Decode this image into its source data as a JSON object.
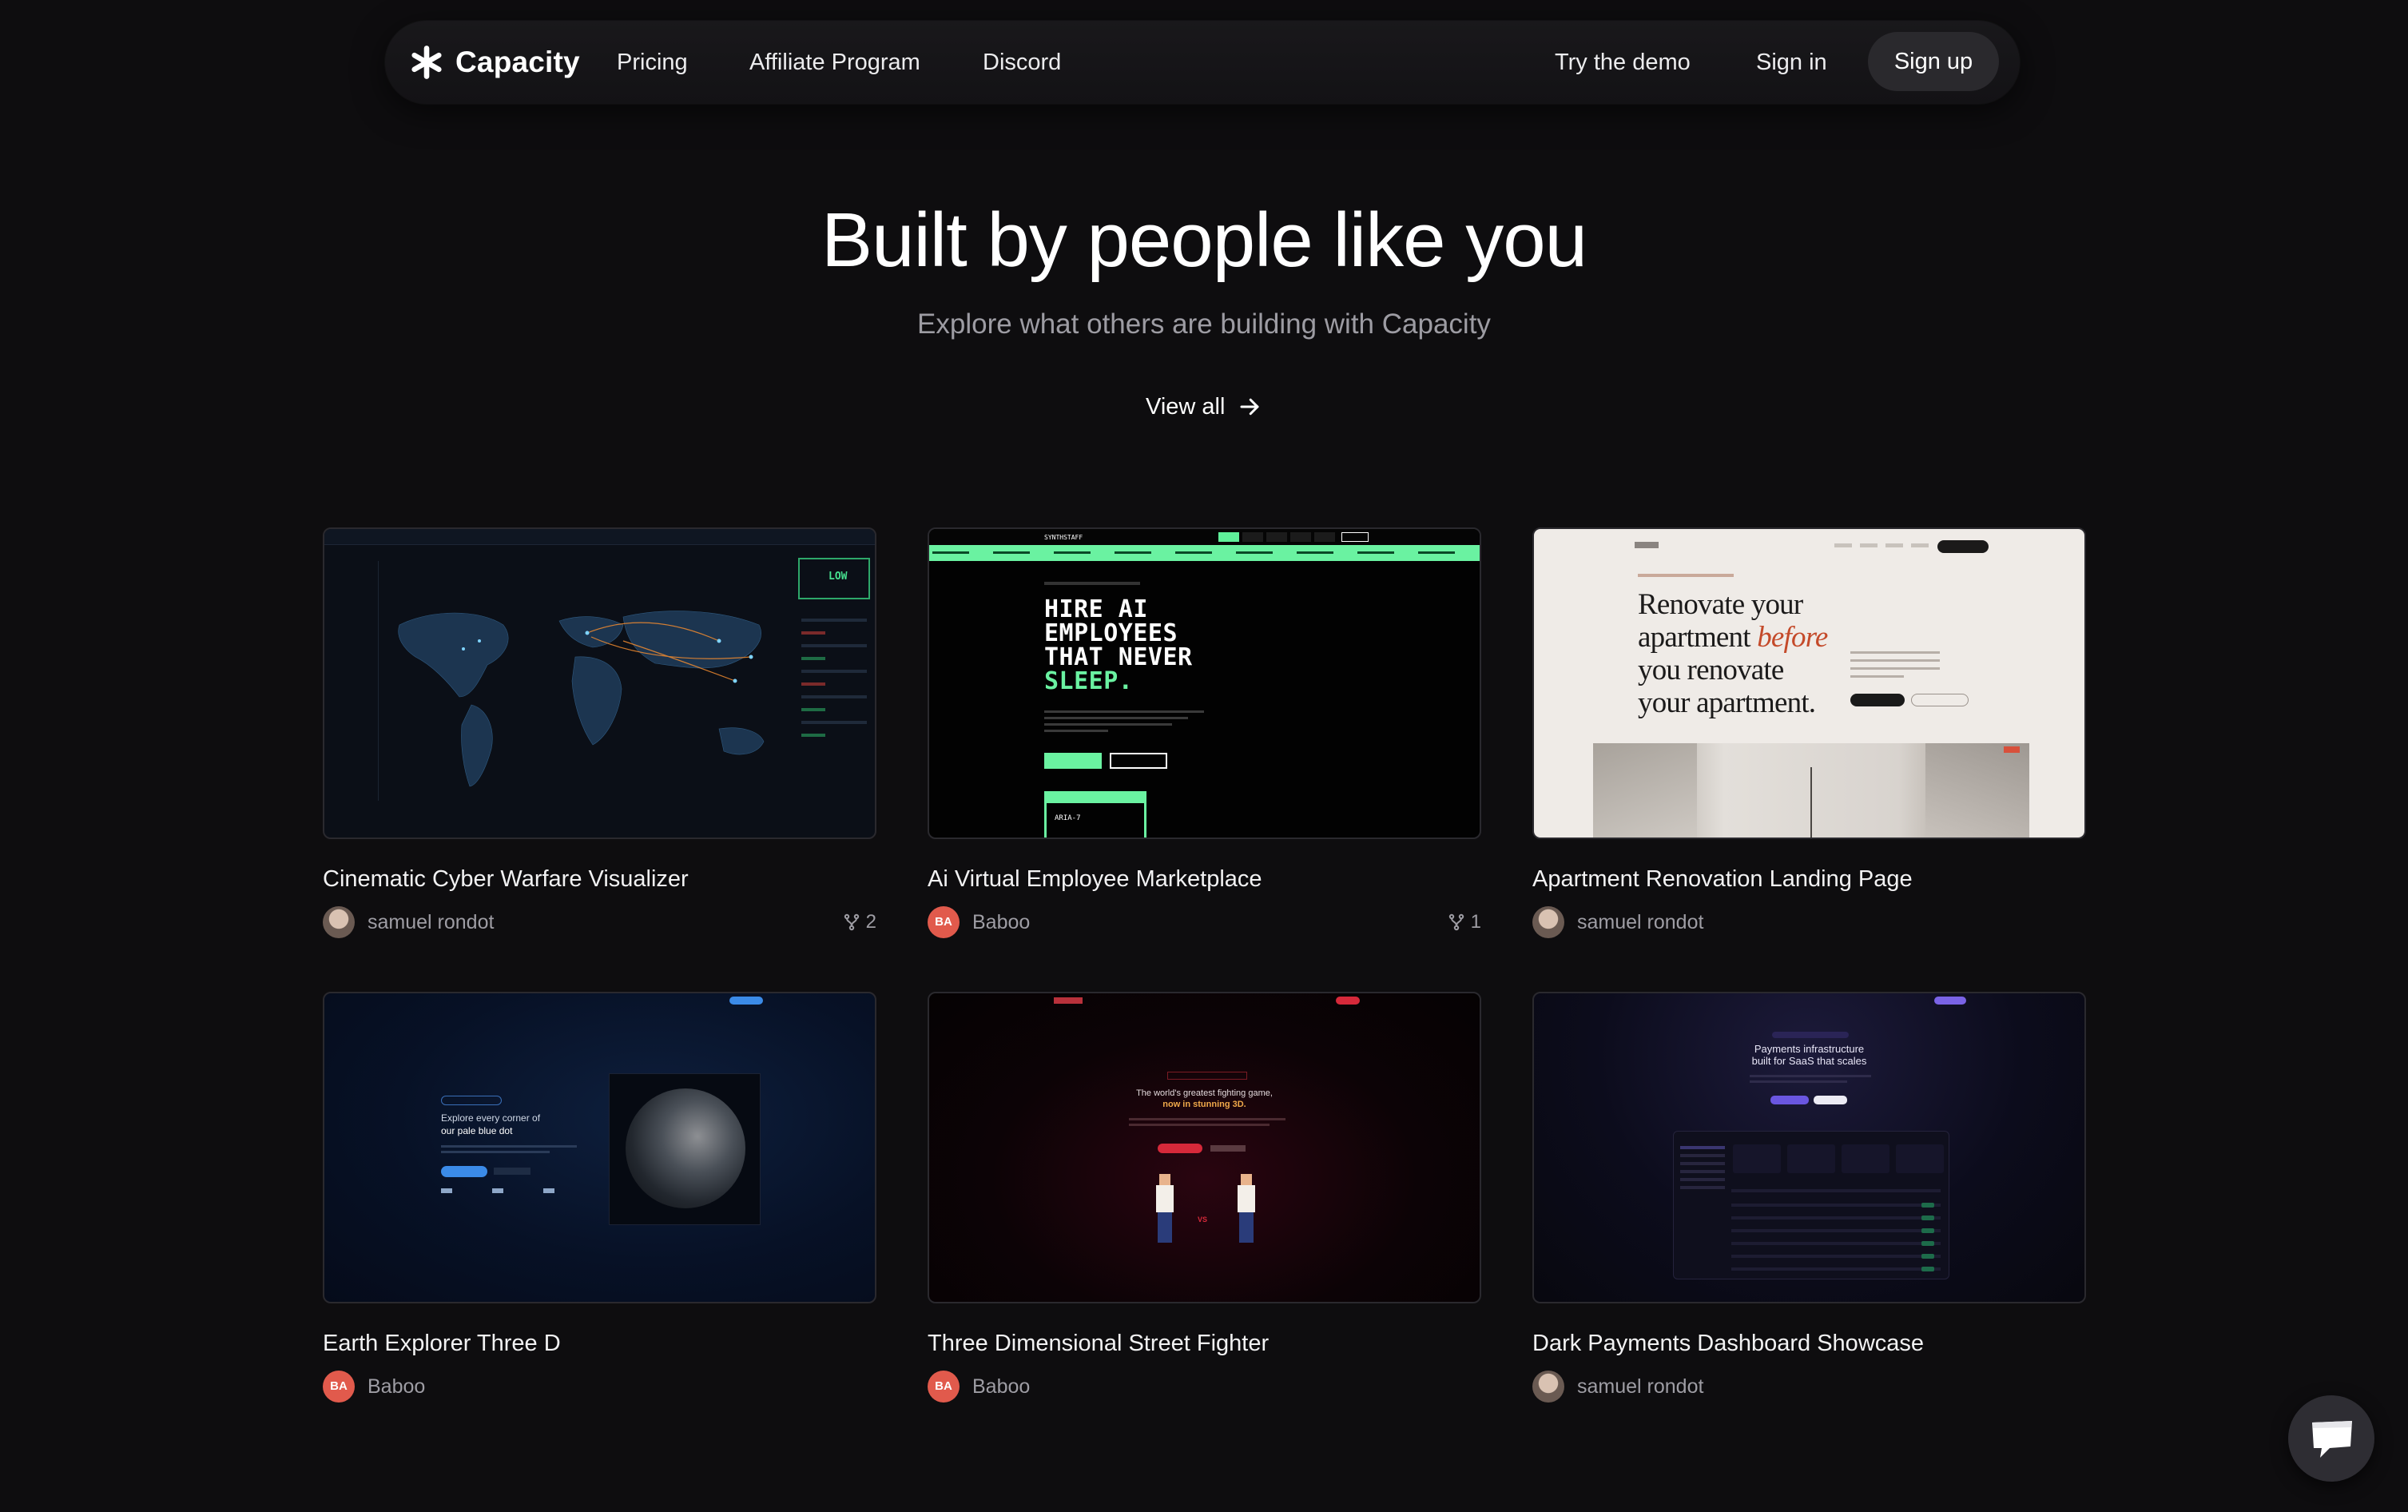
{
  "nav": {
    "brand": "Capacity",
    "links": [
      "Pricing",
      "Affiliate Program",
      "Discord"
    ],
    "try_demo": "Try the demo",
    "sign_in": "Sign in",
    "sign_up": "Sign up"
  },
  "hero": {
    "title": "Built by people like you",
    "subtitle": "Explore what others are building with Capacity",
    "view_all": "View all"
  },
  "projects": [
    {
      "title": "Cinematic Cyber Warfare Visualizer",
      "author": "samuel rondot",
      "avatar": "photo",
      "forks": "2"
    },
    {
      "title": "Ai Virtual Employee Marketplace",
      "author": "Baboo",
      "avatar": "BA",
      "forks": "1"
    },
    {
      "title": "Apartment Renovation Landing Page",
      "author": "samuel rondot",
      "avatar": "photo",
      "forks": ""
    },
    {
      "title": "Earth Explorer Three D",
      "author": "Baboo",
      "avatar": "BA",
      "forks": ""
    },
    {
      "title": "Three Dimensional Street Fighter",
      "author": "Baboo",
      "avatar": "BA",
      "forks": ""
    },
    {
      "title": "Dark Payments Dashboard Showcase",
      "author": "samuel rondot",
      "avatar": "photo",
      "forks": ""
    }
  ],
  "thumbs": {
    "cyber_status": "LOW",
    "hire_logo": "SYNTHSTAFF",
    "hire_l1": "HIRE AI",
    "hire_l2": "EMPLOYEES",
    "hire_l3": "THAT NEVER",
    "hire_l4": "SLEEP.",
    "hire_card": "ARIA-7",
    "reno_l1": "Renovate your",
    "reno_l2a": "apartment ",
    "reno_l2b": "before",
    "reno_l3": "you renovate",
    "reno_l4": "your apartment.",
    "earth_l1": "Explore every corner of",
    "earth_l2": "our pale blue dot",
    "sf_l1": "The world's greatest fighting game,",
    "sf_l2": "now in stunning 3D.",
    "sf_vs": "VS",
    "pay_l1": "Payments infrastructure",
    "pay_l2": "built for SaaS that scales"
  },
  "colors": {
    "background": "#0e0d0f",
    "nav_pill": "#2a292d",
    "avatar_ba": "#e15a4c",
    "muted_text": "#9e9da4"
  },
  "icons": {
    "brand": "asterisk-logo-icon",
    "view_all": "arrow-right-icon",
    "forks": "fork-icon",
    "chat": "chat-bubble-icon"
  }
}
